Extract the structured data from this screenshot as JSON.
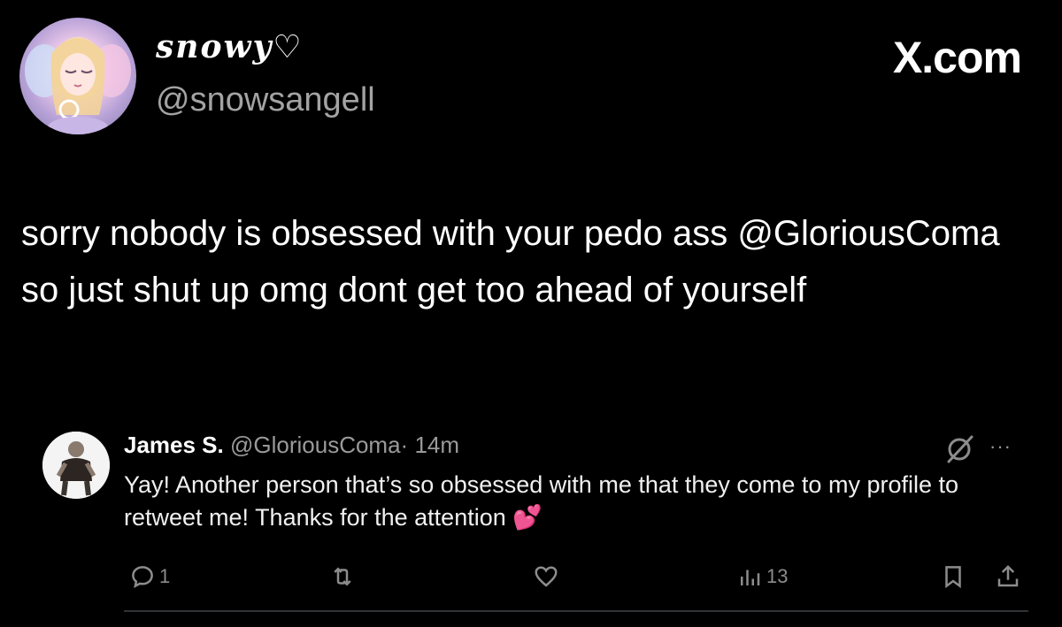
{
  "tweet": {
    "display_name": "snowy♡",
    "handle": "@snowsangell",
    "brand": "X.com",
    "text": "sorry nobody is obsessed with your pedo ass @GloriousComa so just shut up omg dont get too ahead of yourself"
  },
  "reply": {
    "name": "James S.",
    "handle": "@GloriousComa",
    "separator": "·",
    "time": "14m",
    "text": "Yay! Another person that’s so obsessed with me that they come to my profile to retweet me! Thanks for the attention 💕",
    "more": "···",
    "actions": {
      "replies": "1",
      "retweets": "",
      "likes": "",
      "views": "13"
    }
  },
  "icons": {
    "reply": "comment-icon",
    "retweet": "retweet-icon",
    "like": "heart-icon",
    "views": "analytics-icon",
    "bookmark": "bookmark-icon",
    "share": "share-icon",
    "grok": "grok-icon"
  },
  "colors": {
    "background": "#000000",
    "text": "#ffffff",
    "secondary": "#9a9a9a"
  }
}
